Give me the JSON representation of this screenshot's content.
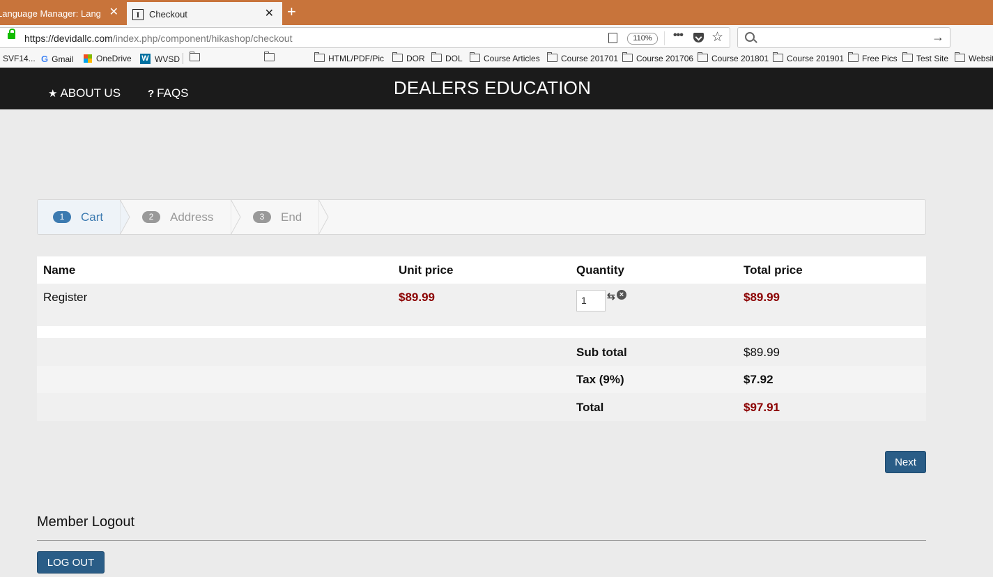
{
  "browser": {
    "tabs": [
      {
        "title": "Language Manager: Language",
        "active": false
      },
      {
        "title": "Checkout",
        "active": true
      }
    ],
    "url_host": "https://devidallc.com",
    "url_path": "/index.php/component/hikashop/checkout",
    "zoom": "110%",
    "bookmarks": [
      "SVF14...",
      "Gmail",
      "OneDrive",
      "WVSD",
      "HTML/PDF/Pic",
      "DOR",
      "DOL",
      "Course Articles",
      "Course 201701",
      "Course 201706",
      "Course 201801",
      "Course 201901",
      "Free Pics",
      "Test Site",
      "Website"
    ]
  },
  "header": {
    "nav": [
      {
        "label": "ABOUT US",
        "icon": "star-icon"
      },
      {
        "label": "FAQS",
        "icon": "question-icon"
      }
    ],
    "title": "DEALERS EDUCATION"
  },
  "steps": [
    {
      "num": "1",
      "label": "Cart",
      "active": true
    },
    {
      "num": "2",
      "label": "Address",
      "active": false
    },
    {
      "num": "3",
      "label": "End",
      "active": false
    }
  ],
  "cart": {
    "columns": [
      "Name",
      "Unit price",
      "Quantity",
      "Total price"
    ],
    "items": [
      {
        "name": "Register",
        "unit_price": "$89.99",
        "quantity": "1",
        "total_price": "$89.99"
      }
    ],
    "subtotal_label": "Sub total",
    "subtotal_value": "$89.99",
    "tax_label": "Tax (9%)",
    "tax_value": "$7.92",
    "total_label": "Total",
    "total_value": "$97.91"
  },
  "buttons": {
    "next": "Next",
    "logout": "LOG OUT"
  },
  "member": {
    "title": "Member Logout"
  },
  "colors": {
    "header_bg": "#1b1b1b",
    "tabbar_bg": "#c8743b",
    "price": "#8b0000",
    "button_bg": "#2a5d87",
    "step_active": "#3c7ab0"
  }
}
